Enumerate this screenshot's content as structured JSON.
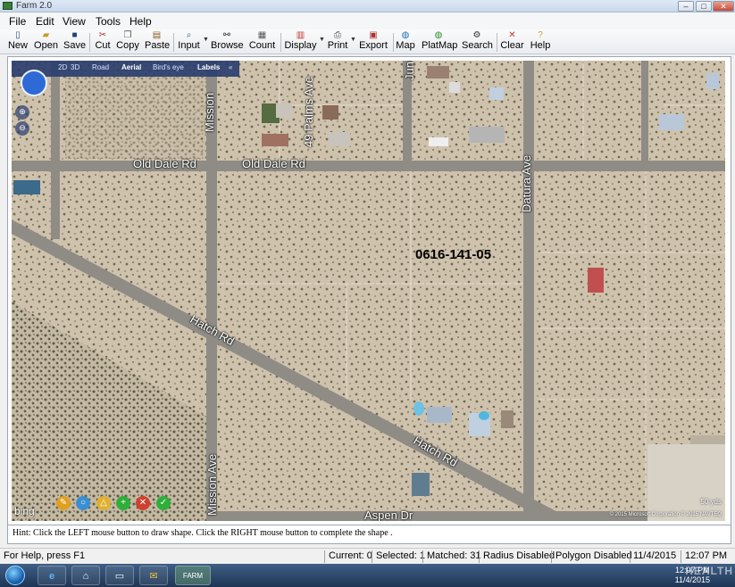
{
  "window": {
    "title": "Farm 2.0",
    "minimize": "–",
    "maximize": "□",
    "close": "✕"
  },
  "menu": [
    "File",
    "Edit",
    "View",
    "Tools",
    "Help"
  ],
  "toolbar": {
    "new": "New",
    "open": "Open",
    "save": "Save",
    "cut": "Cut",
    "copy": "Copy",
    "paste": "Paste",
    "input": "Input",
    "browse": "Browse",
    "count": "Count",
    "display": "Display",
    "print": "Print",
    "export": "Export",
    "map": "Map",
    "platmap": "PlatMap",
    "search": "Search",
    "clear": "Clear",
    "help": "Help"
  },
  "map": {
    "view_tabs": [
      "2D",
      "3D",
      "Road",
      "Aerial",
      "Bird's eye",
      "Labels"
    ],
    "active_tab": "Aerial",
    "parcel_id": "0616-141-05",
    "streets": {
      "old_dale_left": "Old Dale Rd",
      "old_dale_right": "Old Dale Rd",
      "mission_top": "Mission",
      "mission_bottom": "Mission Ave",
      "palms": "49 Palms Ave",
      "jun": "Jun",
      "datura": "Datura Ave",
      "hatch_upper": "Hatch Rd",
      "hatch_lower": "Hatch Rd",
      "aspen": "Aspen Dr"
    },
    "bing_logo": "bing",
    "scale": "50 yds",
    "copyright": "© 2015 Microsoft Corporation © 2015 NAVTEQ"
  },
  "hint": "Hint: Click the LEFT mouse button to draw shape. Click the RIGHT mouse button to complete the shape .",
  "status": {
    "help": "For Help, press F1",
    "current": "Current: 0",
    "selected": "Selected: 1",
    "matched": "Matched: 31",
    "radius": "Radius Disabled",
    "polygon": "Polygon Disabled",
    "date": "11/4/2015",
    "time": "12:07 PM"
  },
  "taskbar": {
    "tray_time": "12:07 PM",
    "tray_date": "11/4/2015",
    "farm_app": "FARM"
  },
  "watermark": "HEALTH",
  "colors": {
    "desert": "#cfc2ad",
    "road": "#8f8c86",
    "bing_bar": "#283c6e",
    "accent": "#2d6ad6"
  }
}
